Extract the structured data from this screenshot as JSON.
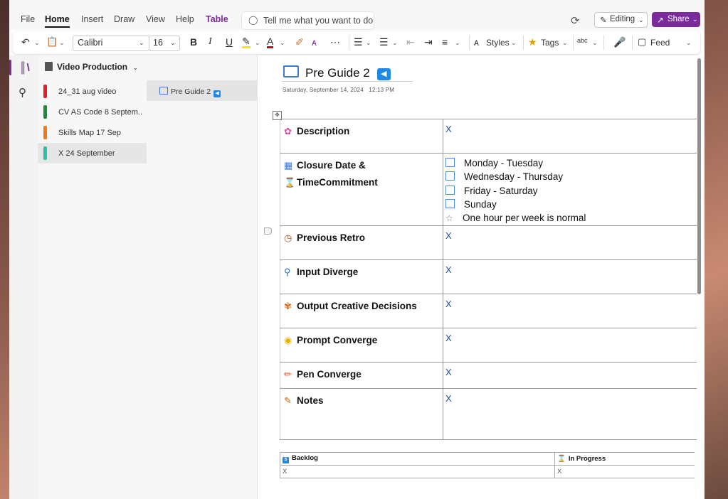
{
  "menu": {
    "items": [
      "File",
      "Home",
      "Insert",
      "Draw",
      "View",
      "Help",
      "Table"
    ],
    "tell_me": "Tell me what you want to do",
    "editing": "Editing",
    "share": "Share"
  },
  "ribbon": {
    "font": "Calibri",
    "size": "16",
    "bold": "B",
    "italic": "I",
    "underline": "U",
    "font_color": "A",
    "more": "⋯",
    "styles": "Styles",
    "tags": "Tags",
    "spell": "abc",
    "feed": "Feed"
  },
  "notebook": {
    "title": "Video Production",
    "sections": [
      {
        "label": "24_31 aug video",
        "color": "#e01f26"
      },
      {
        "label": "CV AS Code 8 Septem...",
        "color": "#1a8c3a"
      },
      {
        "label": "Skills Map 17 Sep",
        "color": "#f07a1c"
      },
      {
        "label": "X 24 September",
        "color": "#2bbfb0"
      }
    ]
  },
  "pages": [
    {
      "label": "Pre Guide 2"
    }
  ],
  "page": {
    "title": "Pre Guide 2",
    "date": "Saturday, September 14, 2024",
    "time": "12:13 PM"
  },
  "table": {
    "rows": [
      {
        "icon": "brain-icon",
        "label": "Description",
        "value": "X"
      },
      {
        "icon": "calendar-icon",
        "label": "Closure Date &",
        "label2": "TimeCommitment",
        "icon2": "hourglass-icon",
        "options": [
          "Monday  - Tuesday",
          "Wednesday - Thursday",
          "Friday - Saturday",
          "Sunday"
        ],
        "note": "One hour per week is normal"
      },
      {
        "icon": "clock-icon",
        "label": "Previous Retro",
        "value": "X"
      },
      {
        "icon": "magnifier-icon",
        "label": "Input Diverge",
        "value": "X"
      },
      {
        "icon": "palette-icon",
        "label": "Output Creative Decisions",
        "value": "X"
      },
      {
        "icon": "bulb-icon",
        "label": "Prompt Converge",
        "value": "X"
      },
      {
        "icon": "pencil-icon",
        "label": "Pen Converge",
        "value": "X"
      },
      {
        "icon": "memo-icon",
        "label": "Notes",
        "value": "X"
      }
    ]
  },
  "board": {
    "headers": [
      "Backlog",
      "In Progress"
    ],
    "values": [
      "X",
      "X"
    ]
  }
}
